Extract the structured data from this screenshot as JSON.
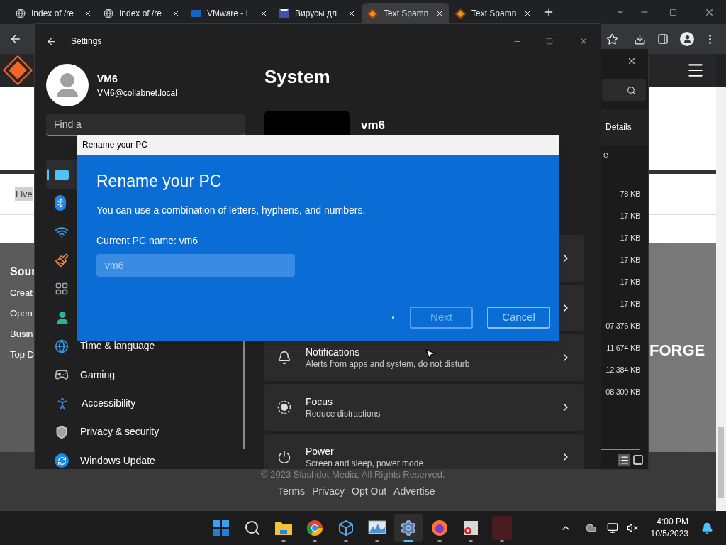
{
  "browser": {
    "tabs": [
      {
        "title": "Index of /re",
        "selected": false
      },
      {
        "title": "Index of /re",
        "selected": false
      },
      {
        "title": "VMware - L",
        "selected": false
      },
      {
        "title": "Вирусы дл",
        "selected": false
      },
      {
        "title": "Text Spamn",
        "selected": true
      },
      {
        "title": "Text Spamn",
        "selected": false
      }
    ]
  },
  "web_page": {
    "live_label": "Live",
    "footer_heading": "Sour",
    "footer_links": [
      "Creat",
      "Open",
      "Busin",
      "Top D"
    ],
    "brand": "FORGE",
    "copyright": "© 2023 Slashdot Media. All Rights Reserved.",
    "legal_links": [
      "Terms",
      "Privacy",
      "Opt Out",
      "Advertise"
    ]
  },
  "file_window": {
    "tab": "Details",
    "column_1": "e",
    "sizes": [
      "78 KB",
      "17 KB",
      "17 KB",
      "17 KB",
      "17 KB",
      "17 KB",
      "07,376 KB",
      "11,674 KB",
      "12,384 KB",
      "08,300 KB"
    ]
  },
  "settings": {
    "title": "Settings",
    "user": {
      "name": "VM6",
      "email": "VM6@collabnet.local"
    },
    "search": {
      "placeholder": "Find a"
    },
    "nav": [
      {
        "selected": true
      },
      {
        "selected": false
      },
      {
        "selected": false
      },
      {
        "selected": false
      },
      {
        "selected": false
      },
      {
        "selected": false
      },
      {
        "label": "Time & language",
        "selected": false
      },
      {
        "label": "Gaming",
        "selected": false
      },
      {
        "label": "Accessibility",
        "selected": false
      },
      {
        "label": "Privacy & security",
        "selected": false
      },
      {
        "label": "Windows Update",
        "selected": false
      }
    ],
    "page_title": "System",
    "device_name": "vm6",
    "cards": [
      {
        "title": "Notifications",
        "subtitle": "Alerts from apps and system, do not disturb"
      },
      {
        "title": "Focus",
        "subtitle": "Reduce distractions"
      },
      {
        "title": "Power",
        "subtitle": "Screen and sleep, power mode"
      }
    ]
  },
  "dialog": {
    "window_title": "Rename your PC",
    "heading": "Rename your PC",
    "description": "You can use a combination of letters, hyphens, and numbers.",
    "current_name": "Current PC name: vm6",
    "input": {
      "placeholder": "vm6"
    },
    "buttons": [
      {
        "label": "Next",
        "disabled": true
      },
      {
        "label": "Cancel",
        "disabled": false
      }
    ]
  },
  "taskbar": {
    "apps": [
      {
        "running": false,
        "active": false
      },
      {
        "running": false,
        "active": false
      },
      {
        "running": true,
        "active": false
      },
      {
        "running": true,
        "active": false
      },
      {
        "running": true,
        "active": false
      },
      {
        "running": true,
        "active": false
      },
      {
        "running": true,
        "active": true
      },
      {
        "running": true,
        "active": false
      },
      {
        "running": true,
        "active": false
      },
      {
        "running": true,
        "active": false
      }
    ],
    "clock": {
      "time": "4:00 PM",
      "date": "10/5/2023"
    }
  }
}
